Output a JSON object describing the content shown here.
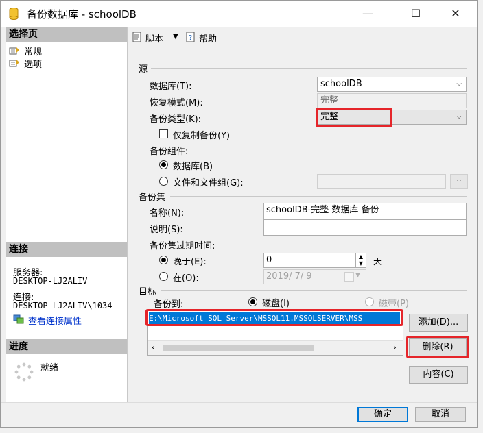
{
  "window": {
    "title": "备份数据库 - schoolDB",
    "minimize": "—",
    "maximize": "☐",
    "close": "✕"
  },
  "left": {
    "select_page_header": "选择页",
    "pages": [
      {
        "label": "常规"
      },
      {
        "label": "选项"
      }
    ],
    "connection_header": "连接",
    "server_label": "服务器:",
    "server_value": "DESKTOP-LJ2ALIV",
    "connection_label": "连接:",
    "connection_value": "DESKTOP-LJ2ALIV\\1034",
    "view_connection_link": "查看连接属性",
    "progress_header": "进度",
    "progress_status": "就绪"
  },
  "toolbar": {
    "script_label": "脚本",
    "script_dropdown": "▼",
    "help_label": "帮助"
  },
  "source": {
    "group_label": "源",
    "database_label": "数据库(T):",
    "database_value": "schoolDB",
    "recovery_label": "恢复模式(M):",
    "recovery_value": "完整",
    "backup_type_label": "备份类型(K):",
    "backup_type_value": "完整",
    "copy_only_label": "仅复制备份(Y)",
    "component_label": "备份组件:",
    "component_db_label": "数据库(B)",
    "component_files_label": "文件和文件组(G):",
    "files_browse": "··"
  },
  "backup_set": {
    "group_label": "备份集",
    "name_label": "名称(N):",
    "name_value": "schoolDB-完整 数据库 备份",
    "desc_label": "说明(S):",
    "desc_value": "",
    "expire_label": "备份集过期时间:",
    "after_label": "晚于(E):",
    "after_value": "0",
    "after_unit": "天",
    "on_label": "在(O):",
    "on_value": "2019/ 7/ 9"
  },
  "destination": {
    "group_label": "目标",
    "backup_to_label": "备份到:",
    "disk_label": "磁盘(I)",
    "tape_label": "磁带(P)",
    "path": "E:\\Microsoft SQL Server\\MSSQL11.MSSQLSERVER\\MSS",
    "add_button": "添加(D)...",
    "remove_button": "删除(R)",
    "contents_button": "内容(C)"
  },
  "footer": {
    "ok_button": "确定",
    "cancel_button": "取消"
  },
  "colors": {
    "highlight_red": "#e5252a",
    "selection_blue": "#0078d7",
    "link_blue": "#0033cc"
  }
}
